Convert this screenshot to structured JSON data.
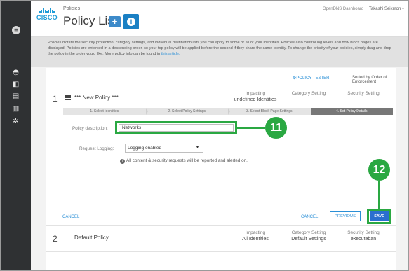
{
  "header": {
    "breadcrumb": "Policies",
    "title": "Policy List",
    "add_button_glyph": "+",
    "info_button_glyph": "i",
    "product": "OpenDNS Dashboard",
    "user": "Takashi Seikmon ▾",
    "logo_text": "CISCO"
  },
  "description": {
    "text": "Policies dictate the security protection, category settings, and individual destination lists you can apply to some or all of your identities.  Policies also control log levels and how block pages are displayed. Policies are enforced in a descending order, so your top policy will be applied before the second if they share the same identity. To change the priority of your policies, simply drag and drop the policy in the order you'd like.  More policy info can be found in",
    "link": "this article."
  },
  "toolbar": {
    "policy_tester": "⚙POLICY TESTER",
    "sort_label": "Sorted by Order of Enforcement"
  },
  "policy1": {
    "number": "1",
    "name": "*** New Policy ***",
    "impacting_label": "Impacting",
    "impacting_value": "undefined Identities",
    "category_label": "Category Setting",
    "security_label": "Security Setting",
    "steps": [
      "1. Select Identities",
      "2. Select Policy Settings",
      "3. Select Block Page Settings",
      "4. Set Policy Details"
    ],
    "description_label": "Policy description:",
    "description_value": "Networks",
    "logging_label": "Request Logging:",
    "logging_value": "Logging enabled",
    "info_text": "All content & security requests will be reported and alerted on.",
    "cancel_left": "CANCEL",
    "cancel_right": "CANCEL",
    "previous": "PREVIOUS",
    "save": "SAVE"
  },
  "policy2": {
    "number": "2",
    "name": "Default Policy",
    "impacting_label": "Impacting",
    "impacting_value": "All Identities",
    "category_label": "Category Setting",
    "category_value": "Default Settings",
    "security_label": "Security Setting",
    "security_value": "executeban"
  },
  "callouts": {
    "badge_11": "11",
    "badge_12": "12"
  },
  "colors": {
    "accent": "#2a8fd6",
    "highlight": "#2aa842",
    "rail": "#2f3133"
  }
}
